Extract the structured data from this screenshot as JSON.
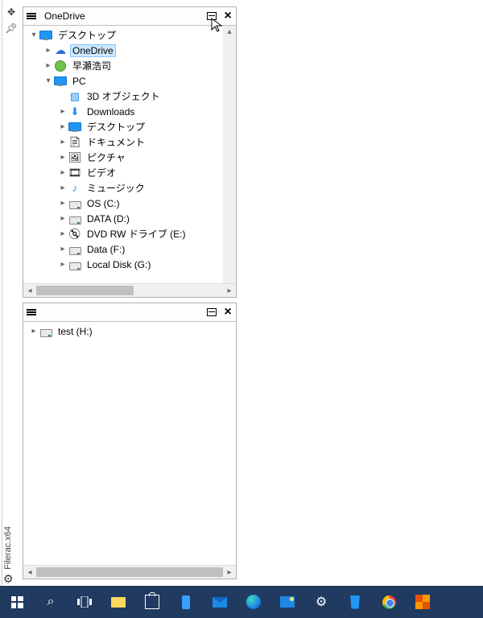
{
  "left_gutter": {
    "move_icon": "move-handle",
    "pin_icon": "pin"
  },
  "app_vertical_label": "Filerac.x64",
  "top_pane": {
    "title": "OneDrive",
    "vscroll_visible": true,
    "hscroll": {
      "thumb_pct": 52
    },
    "tree": [
      {
        "depth": 0,
        "toggle": "down",
        "icon": "desktop",
        "label": "デスクトップ"
      },
      {
        "depth": 1,
        "toggle": "right",
        "icon": "cloud",
        "label": "OneDrive",
        "selected": true
      },
      {
        "depth": 1,
        "toggle": "right",
        "icon": "user",
        "label": "早瀬浩司"
      },
      {
        "depth": 1,
        "toggle": "down",
        "icon": "pc",
        "label": "PC"
      },
      {
        "depth": 2,
        "toggle": "",
        "icon": "3d",
        "label": "3D オブジェクト"
      },
      {
        "depth": 2,
        "toggle": "right",
        "icon": "downloads",
        "label": "Downloads"
      },
      {
        "depth": 2,
        "toggle": "right",
        "icon": "desktop",
        "label": "デスクトップ"
      },
      {
        "depth": 2,
        "toggle": "right",
        "icon": "documents",
        "label": "ドキュメント"
      },
      {
        "depth": 2,
        "toggle": "right",
        "icon": "pictures",
        "label": "ピクチャ"
      },
      {
        "depth": 2,
        "toggle": "right",
        "icon": "videos",
        "label": "ビデオ"
      },
      {
        "depth": 2,
        "toggle": "right",
        "icon": "music",
        "label": "ミュージック"
      },
      {
        "depth": 2,
        "toggle": "right",
        "icon": "drive",
        "label": "OS (C:)"
      },
      {
        "depth": 2,
        "toggle": "right",
        "icon": "drive",
        "label": "DATA (D:)"
      },
      {
        "depth": 2,
        "toggle": "right",
        "icon": "dvd",
        "label": "DVD RW ドライブ (E:)"
      },
      {
        "depth": 2,
        "toggle": "right",
        "icon": "drive",
        "label": "Data (F:)"
      },
      {
        "depth": 2,
        "toggle": "right",
        "icon": "drive",
        "label": "Local Disk (G:)"
      }
    ]
  },
  "bottom_pane": {
    "title": "",
    "hscroll": {
      "thumb_pct": 100
    },
    "tree": [
      {
        "depth": 0,
        "toggle": "right",
        "icon": "drive",
        "label": "test (H:)"
      }
    ]
  },
  "taskbar": {
    "items": [
      {
        "id": "start"
      },
      {
        "id": "search"
      },
      {
        "id": "taskview"
      },
      {
        "id": "explorer"
      },
      {
        "id": "store"
      },
      {
        "id": "phone"
      },
      {
        "id": "mail"
      },
      {
        "id": "edge"
      },
      {
        "id": "photos"
      },
      {
        "id": "settings"
      },
      {
        "id": "recycle"
      },
      {
        "id": "chrome"
      },
      {
        "id": "app-pix"
      }
    ]
  }
}
